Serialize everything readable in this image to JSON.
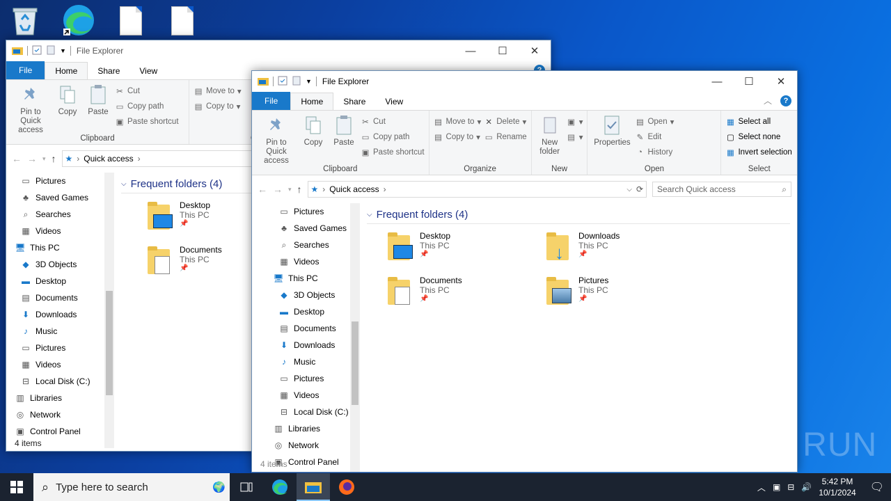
{
  "desktop": {
    "icons": [
      "recycle-bin-icon",
      "edge-shortcut-icon",
      "file-icon",
      "file-icon"
    ],
    "watermark": "ANY RUN"
  },
  "back_window": {
    "title": "File Explorer",
    "tabs": [
      "File",
      "Home",
      "Share",
      "View"
    ],
    "ribbon": {
      "pin": "Pin to Quick access",
      "copy": "Copy",
      "paste": "Paste",
      "cut": "Cut",
      "copy_path": "Copy path",
      "paste_shortcut": "Paste shortcut",
      "move_to": "Move to",
      "copy_to": "Copy to",
      "clipboard": "Clipboard",
      "organize": "Organ"
    },
    "address": "Quick access",
    "nav": [
      "Pictures",
      "Saved Games",
      "Searches",
      "Videos",
      "This PC",
      "3D Objects",
      "Desktop",
      "Documents",
      "Downloads",
      "Music",
      "Pictures",
      "Videos",
      "Local Disk (C:)",
      "Libraries",
      "Network",
      "Control Panel"
    ],
    "group_title": "Frequent folders (4)",
    "tiles": [
      {
        "name": "Desktop",
        "sub": "This PC"
      },
      {
        "name": "Documents",
        "sub": "This PC"
      }
    ],
    "status": "4 items"
  },
  "front_window": {
    "title": "File Explorer",
    "tabs": [
      "File",
      "Home",
      "Share",
      "View"
    ],
    "ribbon": {
      "pin": "Pin to Quick access",
      "copy": "Copy",
      "paste": "Paste",
      "cut": "Cut",
      "copy_path": "Copy path",
      "paste_shortcut": "Paste shortcut",
      "move_to": "Move to",
      "copy_to": "Copy to",
      "delete": "Delete",
      "rename": "Rename",
      "new_folder": "New folder",
      "properties": "Properties",
      "open": "Open",
      "edit": "Edit",
      "history": "History",
      "select_all": "Select all",
      "select_none": "Select none",
      "invert_selection": "Invert selection",
      "groups": [
        "Clipboard",
        "Organize",
        "New",
        "Open",
        "Select"
      ]
    },
    "address": "Quick access",
    "search_placeholder": "Search Quick access",
    "nav": [
      "Pictures",
      "Saved Games",
      "Searches",
      "Videos",
      "This PC",
      "3D Objects",
      "Desktop",
      "Documents",
      "Downloads",
      "Music",
      "Pictures",
      "Videos",
      "Local Disk (C:)",
      "Libraries",
      "Network",
      "Control Panel"
    ],
    "group_title": "Frequent folders (4)",
    "tiles": [
      {
        "name": "Desktop",
        "sub": "This PC"
      },
      {
        "name": "Downloads",
        "sub": "This PC"
      },
      {
        "name": "Documents",
        "sub": "This PC"
      },
      {
        "name": "Pictures",
        "sub": "This PC"
      }
    ],
    "status": "4 items"
  },
  "taskbar": {
    "search_placeholder": "Type here to search",
    "time": "5:42 PM",
    "date": "10/1/2024"
  },
  "colors": {
    "accent": "#1979ca",
    "taskbar": "#1b2330",
    "folder": "#f6d26a"
  }
}
